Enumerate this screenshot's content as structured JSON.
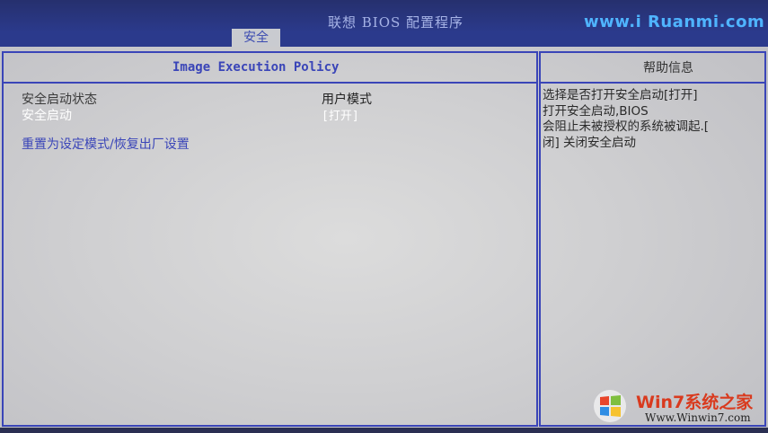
{
  "header": {
    "title": "联想 BIOS 配置程序",
    "watermark": "www.i Ruanmi.com"
  },
  "tabs": [
    {
      "label": "安全",
      "active": true
    }
  ],
  "main": {
    "section_title": "Image Execution Policy",
    "items": [
      {
        "label": "安全启动状态",
        "value": "用户模式"
      },
      {
        "label": "安全启动",
        "value": "[打开]",
        "selected": true
      },
      {
        "label": "重置为设定模式/恢复出厂设置"
      }
    ]
  },
  "help": {
    "title": "帮助信息",
    "lines": [
      "选择是否打开安全启动[打开]",
      "打开安全启动,BIOS",
      "会阻止未被授权的系统被调起.[",
      "闭] 关闭安全启动"
    ]
  },
  "watermark_bottom": {
    "brand": "Win7系统之家",
    "url": "Www.Winwin7.com"
  },
  "colors": {
    "bios_blue": "#2b3a8c",
    "border_blue": "#3a45b8",
    "background": "#cfcfd1"
  }
}
